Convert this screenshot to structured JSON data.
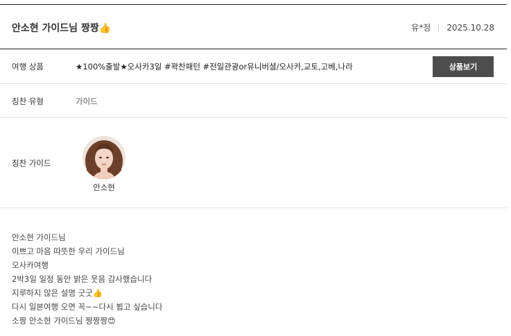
{
  "review": {
    "title": "안소현 가이드님 짱짱👍",
    "author": "유*정",
    "date": "2025.10.28"
  },
  "details": {
    "product_label": "여행 상품",
    "product_value": "★100%출발★오사카3일 #꽉찬패턴 #전일관광or유니버셜/오사카,교토,고베,나라",
    "product_button": "상품보기",
    "type_label": "칭찬 유형",
    "type_value": "가이드",
    "guide_label": "칭찬 가이드",
    "guide_name": "안소현"
  },
  "body_lines": [
    "안소현 가이드님",
    "이쁘고 마음 따뜻한 우리 가이드님",
    "오사카여행",
    "2박3일 일정 동안 밝은 웃음 감사했습니다",
    "지루하지 않은 설명 굿굿👍",
    "다시 일본여행 오면 꼭~~다시 뵙고 싶습니다",
    "소짱 안소현 가이드님 짱짱짱😍"
  ]
}
